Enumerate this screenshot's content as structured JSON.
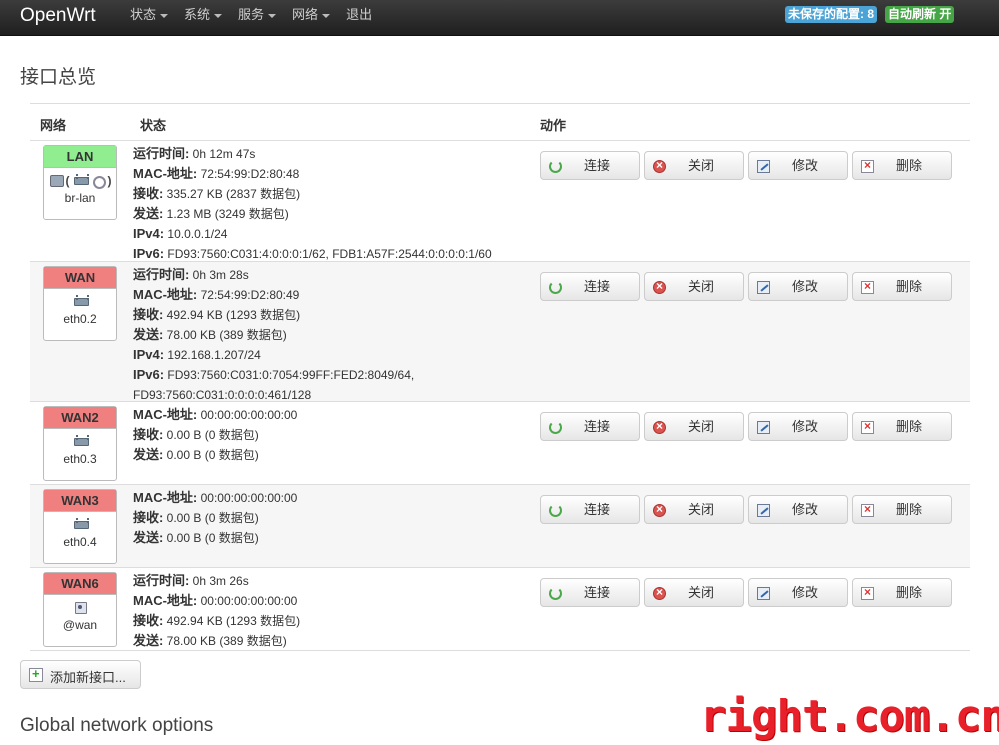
{
  "navbar": {
    "brand": "OpenWrt",
    "menu": [
      "状态",
      "系统",
      "服务",
      "网络",
      "退出"
    ],
    "unsaved_badge": "未保存的配置: 8",
    "refresh_badge": "自动刷新 开"
  },
  "page_title": "接口总览",
  "table": {
    "headers": {
      "network": "网络",
      "status": "状态",
      "actions": "动作"
    },
    "buttons": {
      "connect": "连接",
      "close": "关闭",
      "edit": "修改",
      "delete": "删除"
    },
    "rows": [
      {
        "name": "LAN",
        "device": "br-lan",
        "status_color": "green",
        "fields": [
          {
            "k": "运行时间:",
            "v": " 0h 12m 47s"
          },
          {
            "k": "MAC-地址:",
            "v": " 72:54:99:D2:80:48"
          },
          {
            "k": "接收:",
            "v": " 335.27 KB (2837 数据包)"
          },
          {
            "k": "发送:",
            "v": " 1.23 MB (3249 数据包)"
          },
          {
            "k": "IPv4:",
            "v": " 10.0.0.1/24"
          },
          {
            "k": "IPv6:",
            "v": " FD93:7560:C031:4:0:0:0:1/62, FDB1:A57F:2544:0:0:0:0:1/60"
          }
        ]
      },
      {
        "name": "WAN",
        "device": "eth0.2",
        "status_color": "red",
        "fields": [
          {
            "k": "运行时间:",
            "v": " 0h 3m 28s"
          },
          {
            "k": "MAC-地址:",
            "v": " 72:54:99:D2:80:49"
          },
          {
            "k": "接收:",
            "v": " 492.94 KB (1293 数据包)"
          },
          {
            "k": "发送:",
            "v": " 78.00 KB (389 数据包)"
          },
          {
            "k": "IPv4:",
            "v": " 192.168.1.207/24"
          },
          {
            "k": "IPv6:",
            "v": " FD93:7560:C031:0:7054:99FF:FED2:8049/64,"
          },
          {
            "k": "",
            "v": "FD93:7560:C031:0:0:0:0:461/128"
          }
        ]
      },
      {
        "name": "WAN2",
        "device": "eth0.3",
        "status_color": "red",
        "fields": [
          {
            "k": "MAC-地址:",
            "v": " 00:00:00:00:00:00"
          },
          {
            "k": "接收:",
            "v": " 0.00 B (0 数据包)"
          },
          {
            "k": "发送:",
            "v": " 0.00 B (0 数据包)"
          }
        ]
      },
      {
        "name": "WAN3",
        "device": "eth0.4",
        "status_color": "red",
        "fields": [
          {
            "k": "MAC-地址:",
            "v": " 00:00:00:00:00:00"
          },
          {
            "k": "接收:",
            "v": " 0.00 B (0 数据包)"
          },
          {
            "k": "发送:",
            "v": " 0.00 B (0 数据包)"
          }
        ]
      },
      {
        "name": "WAN6",
        "device": "@wan",
        "status_color": "red",
        "fields": [
          {
            "k": "运行时间:",
            "v": " 0h 3m 26s"
          },
          {
            "k": "MAC-地址:",
            "v": " 00:00:00:00:00:00"
          },
          {
            "k": "接收:",
            "v": " 492.94 KB (1293 数据包)"
          },
          {
            "k": "发送:",
            "v": " 78.00 KB (389 数据包)"
          }
        ]
      }
    ]
  },
  "add_button": "添加新接口...",
  "global_title": "Global network options",
  "watermark": "right.com.cn"
}
